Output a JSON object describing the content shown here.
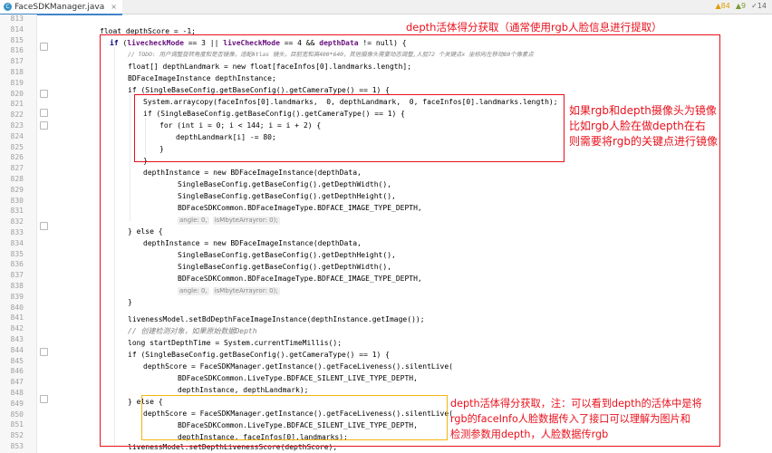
{
  "tab": {
    "icon": "java-class-icon",
    "label": "FaceSDKManager.java",
    "close": "×"
  },
  "inspections": {
    "warnings": "▲84",
    "weak": "▲9",
    "typos": "✓14"
  },
  "line_numbers": [
    "813",
    "814",
    "815",
    "816",
    "817",
    "818",
    "819",
    "820",
    "821",
    "822",
    "823",
    "824",
    "825",
    "826",
    "827",
    "828",
    "829",
    "830",
    "831",
    "832",
    "833",
    "834",
    "835",
    "836",
    "837",
    "838",
    "839",
    "840",
    "841",
    "842",
    "843",
    "844",
    "845",
    "846",
    "847",
    "848",
    "849",
    "850",
    "851",
    "852",
    "853"
  ],
  "code": {
    "l0": "float depthScore = -1;",
    "l1_kw": "if",
    "l1_a": " (",
    "l1_f1": "livecheckMode",
    "l1_b": " == 3 || ",
    "l1_f2": "liveCheckMode",
    "l1_c": " == 4 && ",
    "l1_f3": "depthData",
    "l1_d": " != null) {",
    "l2": "// TODO: 用户调整旋转角度和是否镜像，适配Atlas 镜头，目前宽和高400*640，其他摄像头需要动态调整,人脸72 个关键点x 坐标向左移动80个像素点",
    "l3": "float[] depthLandmark = new float[faceInfos[0].landmarks.length];",
    "l4": "BDFaceImageInstance depthInstance;",
    "l5": "if (SingleBaseConfig.getBaseConfig().getCameraType() == 1) {",
    "l6": "System.arraycopy(faceInfos[0].landmarks,  0, depthLandmark,  0, faceInfos[0].landmarks.length);",
    "l7": "if (SingleBaseConfig.getBaseConfig().getCameraType() == 1) {",
    "l8": "for (int i = 0; i < 144; i = i + 2) {",
    "l9": "depthLandmark[i] -= 80;",
    "l10": "}",
    "l11": "}",
    "l12": "depthInstance = new BDFaceImageInstance(depthData,",
    "l13": "SingleBaseConfig.getBaseConfig().getDepthWidth(),",
    "l14": "SingleBaseConfig.getBaseConfig().getDepthHeight(),",
    "l15": "BDFaceSDKCommon.BDFaceImageType.BDFACE_IMAGE_TYPE_DEPTH,",
    "l16_h1": "angle: 0,",
    "l16_h2": "isMbyteArrayror: 0);",
    "l17": "} else {",
    "l18": "depthInstance = new BDFaceImageInstance(depthData,",
    "l19": "SingleBaseConfig.getBaseConfig().getDepthHeight(),",
    "l20": "SingleBaseConfig.getBaseConfig().getDepthWidth(),",
    "l21": "BDFaceSDKCommon.BDFaceImageType.BDFACE_IMAGE_TYPE_DEPTH,",
    "l22_h1": "angle: 0,",
    "l22_h2": "isMbyteArrayror: 0);",
    "l23": "}",
    "l24": "",
    "l25": "livenessModel.setBdDepthFaceImageInstance(depthInstance.getImage());",
    "l26": "// 创建检测对象，如果原始数据Depth",
    "l27": "long startDepthTime = System.currentTimeMillis();",
    "l28": "if (SingleBaseConfig.getBaseConfig().getCameraType() == 1) {",
    "l29": "depthScore = FaceSDKManager.getInstance().getFaceLiveness().silentLive(",
    "l30": "BDFaceSDKCommon.LiveType.BDFACE_SILENT_LIVE_TYPE_DEPTH,",
    "l31": "depthInstance, depthLandmark);",
    "l32": "} else {",
    "l33": "depthScore = FaceSDKManager.getInstance().getFaceLiveness().silentLive(",
    "l34": "BDFaceSDKCommon.LiveType.BDFACE_SILENT_LIVE_TYPE_DEPTH,",
    "l35": "depthInstance, faceInfos[0].landmarks);",
    "l36": "}",
    "l37": "livenessModel.setDepthLivenessScore(depthScore);"
  },
  "annotations": {
    "top": "depth活体得分获取（通常使用rgb人脸信息进行提取）",
    "mid_1": "如果rgb和depth摄像头为镜像",
    "mid_2": "比如rgb人脸在做depth在右",
    "mid_3": "则需要将rgb的关键点进行镜像",
    "bot_1": "depth活体得分获取，注：可以看到depth的活体中是将",
    "bot_2": "rgb的faceInfo人脸数据传入了接口可以理解为图片和",
    "bot_3": "检测参数用depth，人脸数据传rgb"
  },
  "colors": {
    "annotation_red": "#e8111c",
    "annotation_yellow": "#f3b40e"
  }
}
